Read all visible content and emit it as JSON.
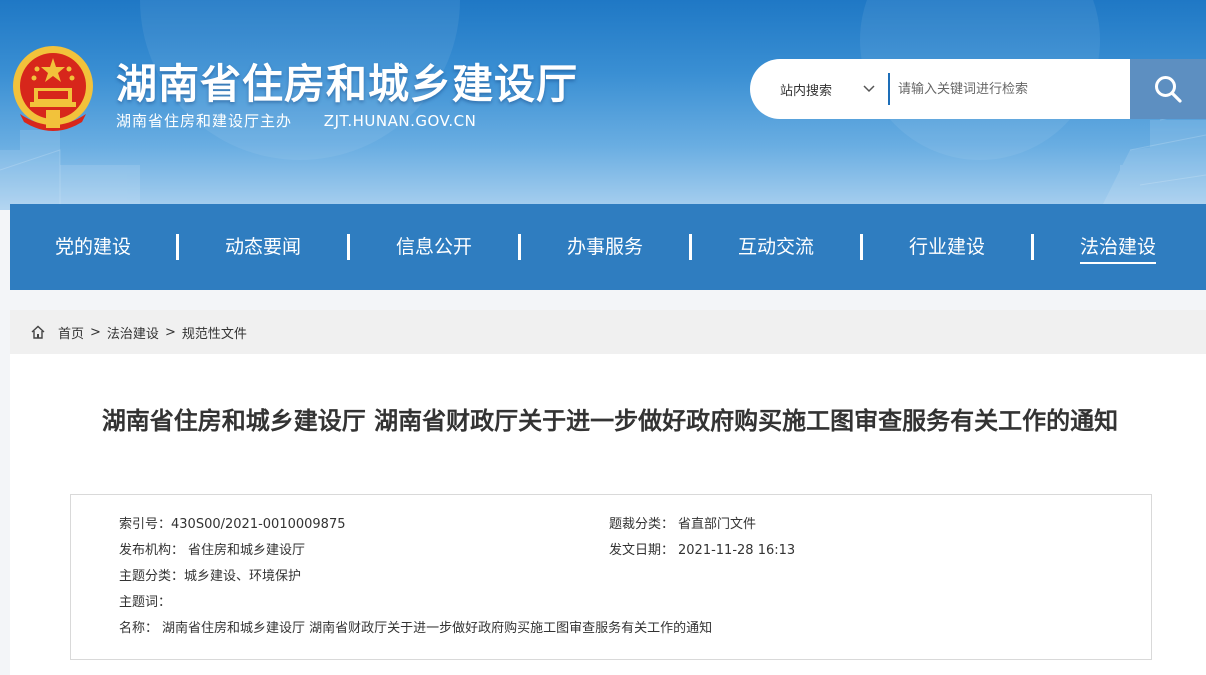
{
  "header": {
    "site_title": "湖南省住房和城乡建设厅",
    "site_subtitle": "湖南省住房和建设厅主办",
    "site_domain": "ZJT.HUNAN.GOV.CN"
  },
  "search": {
    "scope_label": "站内搜索",
    "placeholder": "请输入关键词进行检索",
    "button_icon": "search-icon"
  },
  "nav": {
    "items": [
      {
        "label": "党的建设"
      },
      {
        "label": "动态要闻"
      },
      {
        "label": "信息公开"
      },
      {
        "label": "办事服务"
      },
      {
        "label": "互动交流"
      },
      {
        "label": "行业建设"
      },
      {
        "label": "法治建设",
        "active": true
      }
    ]
  },
  "breadcrumb": {
    "home_icon": "home-icon",
    "items": [
      "首页",
      "法治建设",
      "规范性文件"
    ],
    "separator": ">"
  },
  "article": {
    "title": "湖南省住房和城乡建设厅 湖南省财政厅关于进一步做好政府购买施工图审查服务有关工作的通知",
    "meta": {
      "index_label": "索引号：",
      "index_value": "430S00/2021-0010009875",
      "genre_label": "题裁分类：",
      "genre_value": "省直部门文件",
      "publisher_label": "发布机构：",
      "publisher_value": "省住房和城乡建设厅",
      "date_label": "发文日期：",
      "date_value": "2021-11-28 16:13",
      "topic_label": "主题分类：",
      "topic_value": "城乡建设、环境保护",
      "keywords_label": "主题词：",
      "keywords_value": "",
      "name_label": "名称：",
      "name_value": "湖南省住房和城乡建设厅 湖南省财政厅关于进一步做好政府购买施工图审查服务有关工作的通知"
    }
  },
  "colors": {
    "banner_top": "#1f78c5",
    "nav_bg": "#2f7dc0",
    "search_btn": "#5d8fc1",
    "emblem_red": "#d7261b",
    "emblem_gold": "#f2c23b"
  }
}
